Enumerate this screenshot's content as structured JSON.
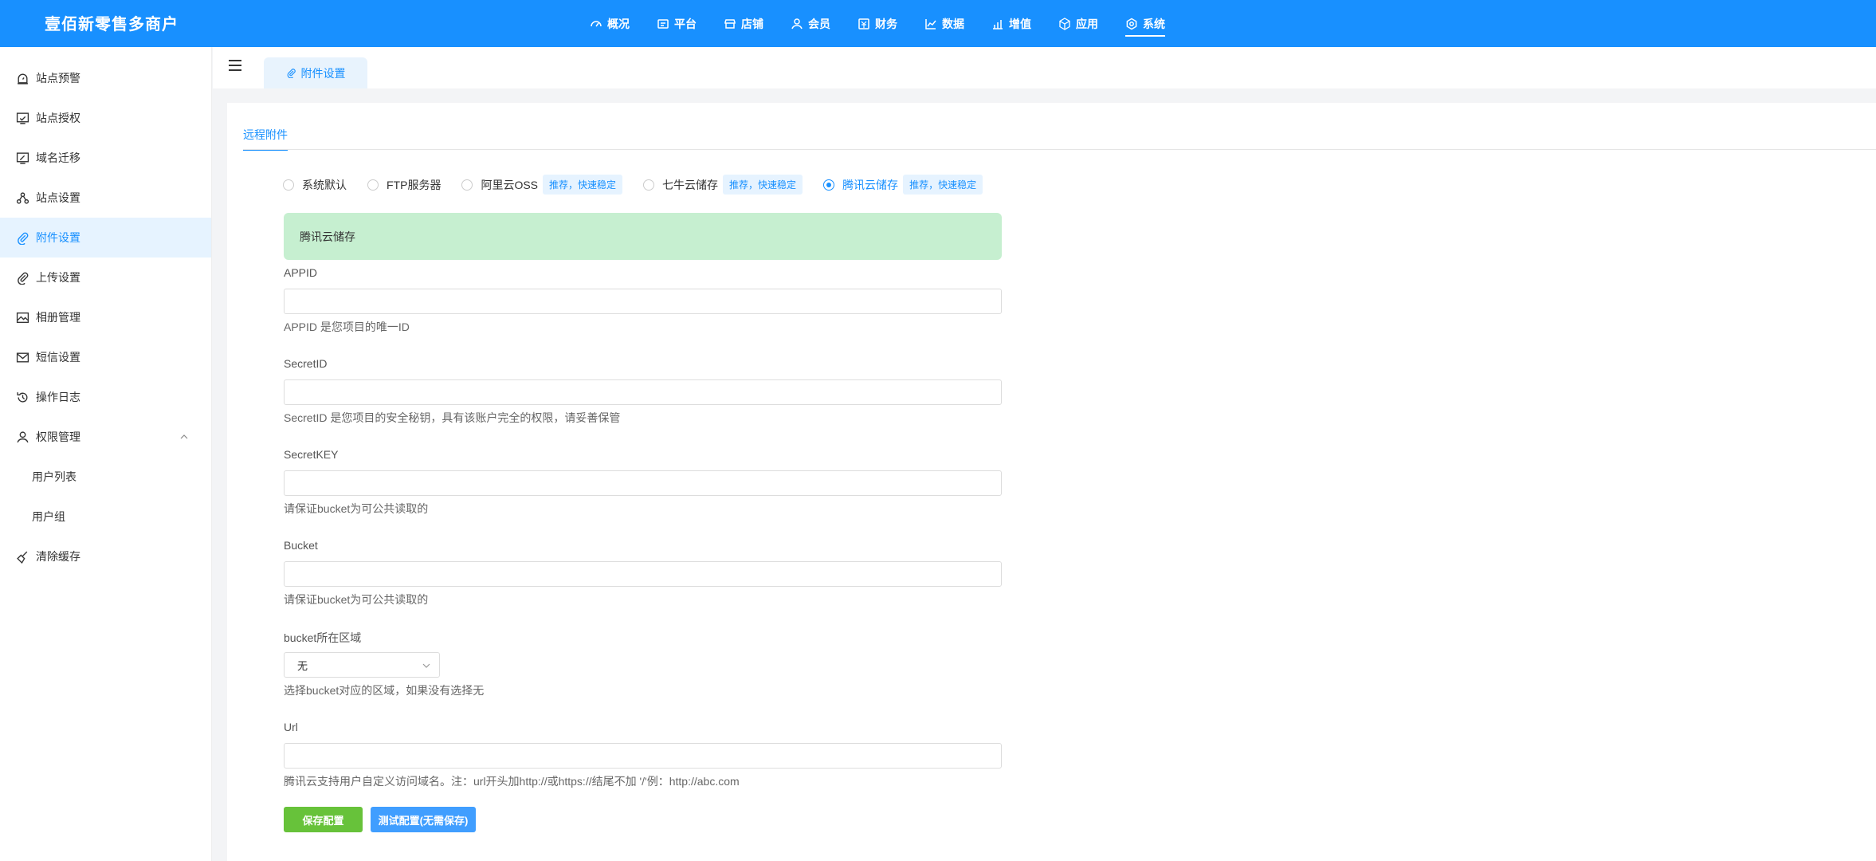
{
  "app": {
    "title": "壹佰新零售多商户"
  },
  "topnav": [
    {
      "label": "概况",
      "icon": "dashboard-icon"
    },
    {
      "label": "平台",
      "icon": "platform-icon"
    },
    {
      "label": "店铺",
      "icon": "store-icon"
    },
    {
      "label": "会员",
      "icon": "user-icon"
    },
    {
      "label": "财务",
      "icon": "finance-icon"
    },
    {
      "label": "数据",
      "icon": "chart-icon"
    },
    {
      "label": "增值",
      "icon": "growth-icon"
    },
    {
      "label": "应用",
      "icon": "cube-icon"
    },
    {
      "label": "系统",
      "icon": "gear-icon",
      "active": true
    }
  ],
  "sidebar": {
    "items": [
      {
        "label": "站点预警"
      },
      {
        "label": "站点授权"
      },
      {
        "label": "域名迁移"
      },
      {
        "label": "站点设置"
      },
      {
        "label": "附件设置",
        "active": true
      },
      {
        "label": "上传设置"
      },
      {
        "label": "相册管理"
      },
      {
        "label": "短信设置"
      },
      {
        "label": "操作日志"
      },
      {
        "label": "权限管理"
      },
      {
        "label": "用户列表"
      },
      {
        "label": "用户组"
      },
      {
        "label": "清除缓存"
      }
    ]
  },
  "tabs": {
    "current": "附件设置"
  },
  "subtab": {
    "label": "远程附件"
  },
  "storage_options": [
    {
      "label": "系统默认",
      "badge": ""
    },
    {
      "label": "FTP服务器",
      "badge": ""
    },
    {
      "label": "阿里云OSS",
      "badge": "推荐，快速稳定"
    },
    {
      "label": "七牛云储存",
      "badge": "推荐，快速稳定"
    },
    {
      "label": "腾讯云储存",
      "badge": "推荐，快速稳定",
      "checked": true
    }
  ],
  "alert": {
    "text": "腾讯云储存"
  },
  "form": {
    "appid": {
      "label": "APPID",
      "value": "",
      "help": "APPID 是您项目的唯一ID"
    },
    "secretid": {
      "label": "SecretID",
      "value": "",
      "help": "SecretID 是您项目的安全秘钥，具有该账户完全的权限，请妥善保管"
    },
    "secretkey": {
      "label": "SecretKEY",
      "value": "",
      "help": "请保证bucket为可公共读取的"
    },
    "bucket": {
      "label": "Bucket",
      "value": "",
      "help": "请保证bucket为可公共读取的"
    },
    "region": {
      "label": "bucket所在区域",
      "value": "无",
      "help": "选择bucket对应的区域，如果没有选择无"
    },
    "url": {
      "label": "Url",
      "value": "",
      "help": "腾讯云支持用户自定义访问域名。注：url开头加http://或https://结尾不加 '/'例：http://abc.com"
    }
  },
  "buttons": {
    "save": "保存配置",
    "test": "测试配置(无需保存)"
  },
  "colors": {
    "primary": "#1890ff",
    "success": "#67c23a",
    "alert_bg": "#c6efd0"
  }
}
